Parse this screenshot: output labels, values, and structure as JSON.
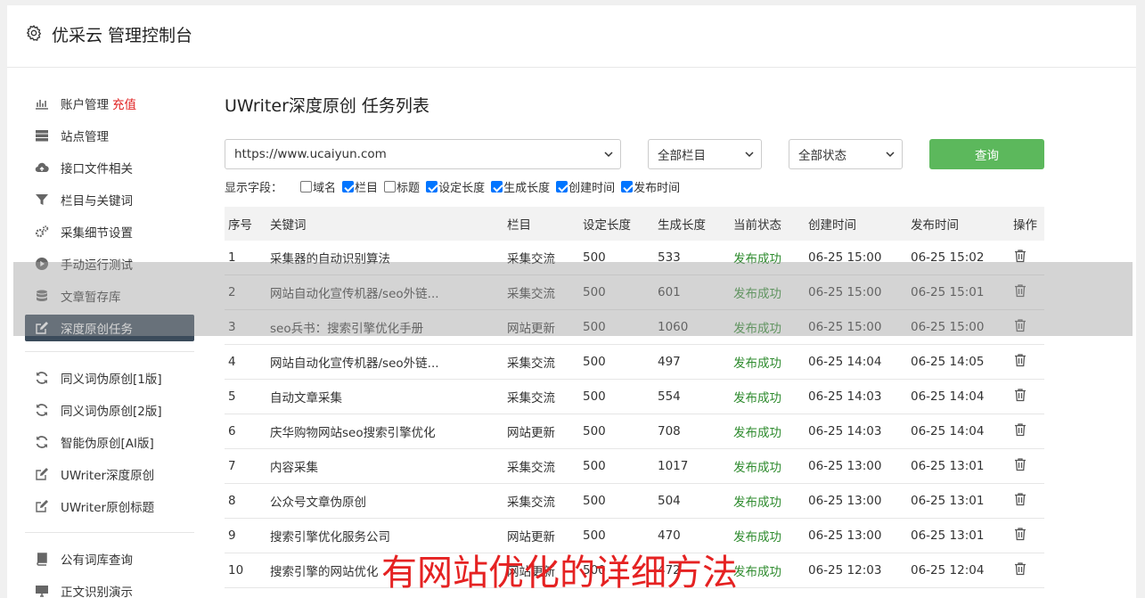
{
  "header": {
    "title": "优采云 管理控制台"
  },
  "sidebar": {
    "groups": [
      [
        {
          "label": "账户管理",
          "badge": "充值",
          "icon": "bar-chart-icon"
        },
        {
          "label": "站点管理",
          "icon": "server-icon"
        },
        {
          "label": "接口文件相关",
          "icon": "cloud-upload-icon"
        },
        {
          "label": "栏目与关键词",
          "icon": "filter-icon"
        },
        {
          "label": "采集细节设置",
          "icon": "gears-icon"
        },
        {
          "label": "手动运行测试",
          "icon": "play-circle-icon"
        },
        {
          "label": "文章暂存库",
          "icon": "database-icon"
        },
        {
          "label": "深度原创任务",
          "icon": "edit-icon",
          "active": true
        }
      ],
      [
        {
          "label": "同义词伪原创[1版]",
          "icon": "refresh-icon"
        },
        {
          "label": "同义词伪原创[2版]",
          "icon": "refresh-icon"
        },
        {
          "label": "智能伪原创[AI版]",
          "icon": "refresh-icon"
        },
        {
          "label": "UWriter深度原创",
          "icon": "edit-icon"
        },
        {
          "label": "UWriter原创标题",
          "icon": "edit-icon"
        }
      ],
      [
        {
          "label": "公有词库查询",
          "icon": "book-icon"
        },
        {
          "label": "正文识别演示",
          "icon": "monitor-icon"
        }
      ]
    ]
  },
  "main": {
    "title": "UWriter深度原创 任务列表",
    "site_select": "https://www.ucaiyun.com",
    "column_select": "全部栏目",
    "status_select": "全部状态",
    "query_button": "查询",
    "fields_label": "显示字段：",
    "fields": [
      {
        "label": "域名",
        "checked": false
      },
      {
        "label": "栏目",
        "checked": true
      },
      {
        "label": "标题",
        "checked": false
      },
      {
        "label": "设定长度",
        "checked": true
      },
      {
        "label": "生成长度",
        "checked": true
      },
      {
        "label": "创建时间",
        "checked": true
      },
      {
        "label": "发布时间",
        "checked": true
      }
    ],
    "table": {
      "headers": [
        "序号",
        "关键词",
        "栏目",
        "设定长度",
        "生成长度",
        "当前状态",
        "创建时间",
        "发布时间",
        "操作"
      ],
      "rows": [
        [
          "1",
          "采集器的自动识别算法",
          "采集交流",
          "500",
          "533",
          "发布成功",
          "06-25 15:00",
          "06-25 15:02"
        ],
        [
          "2",
          "网站自动化宣传机器/seo外链...",
          "采集交流",
          "500",
          "601",
          "发布成功",
          "06-25 15:00",
          "06-25 15:01"
        ],
        [
          "3",
          "seo兵书：搜索引擎优化手册",
          "网站更新",
          "500",
          "1060",
          "发布成功",
          "06-25 15:00",
          "06-25 15:00"
        ],
        [
          "4",
          "网站自动化宣传机器/seo外链...",
          "采集交流",
          "500",
          "497",
          "发布成功",
          "06-25 14:04",
          "06-25 14:05"
        ],
        [
          "5",
          "自动文章采集",
          "采集交流",
          "500",
          "554",
          "发布成功",
          "06-25 14:03",
          "06-25 14:04"
        ],
        [
          "6",
          "庆华购物网站seo搜索引擎优化",
          "网站更新",
          "500",
          "708",
          "发布成功",
          "06-25 14:03",
          "06-25 14:04"
        ],
        [
          "7",
          "内容采集",
          "采集交流",
          "500",
          "1017",
          "发布成功",
          "06-25 13:00",
          "06-25 13:01"
        ],
        [
          "8",
          "公众号文章伪原创",
          "采集交流",
          "500",
          "504",
          "发布成功",
          "06-25 13:00",
          "06-25 13:01"
        ],
        [
          "9",
          "搜索引擎优化服务公司",
          "网站更新",
          "500",
          "470",
          "发布成功",
          "06-25 13:00",
          "06-25 13:01"
        ],
        [
          "10",
          "搜索引擎的网站优化",
          "网站更新",
          "500",
          "472",
          "发布成功",
          "06-25 12:03",
          "06-25 12:04"
        ]
      ]
    }
  },
  "watermark": "有网站优化的详细方法",
  "colors": {
    "accent_green": "#5cb85c",
    "active_nav": "#3b4b5b",
    "status_success": "#2e8b2e",
    "recharge_red": "#e02020",
    "watermark_red": "#e52222"
  }
}
